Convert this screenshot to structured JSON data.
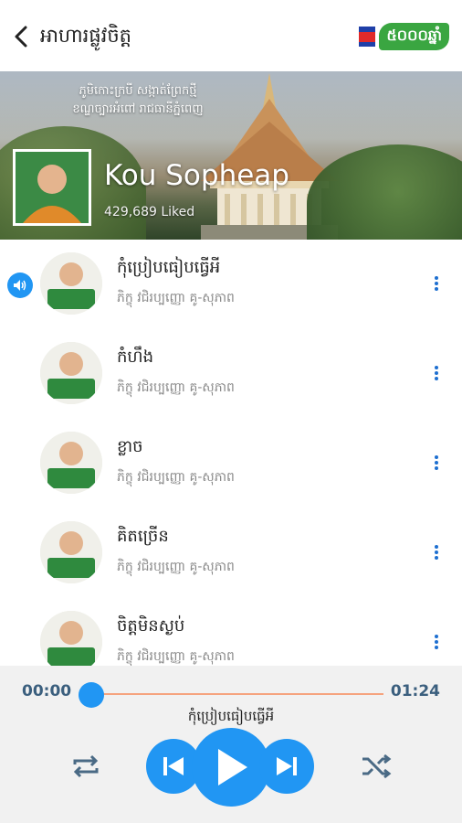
{
  "header": {
    "title": "អាហារផ្លូវចិត្ត",
    "logo_text": "៥០០០ឆ្នាំ"
  },
  "banner": {
    "caption_line1": "ភូមិកោះក្របី សង្កាត់ព្រែកថ្មី",
    "caption_line2": "ខណ្ឌច្បារអំពៅ រាជធានីភ្នំពេញ",
    "artist_name": "Kou Sopheap",
    "liked_text": "429,689 Liked"
  },
  "tracks": [
    {
      "title": "កុំប្រៀបធៀបធ្វើអី",
      "subtitle": "ភិក្ខុ វជិរប្បញ្ញោ គូ-សុភាព",
      "playing": true
    },
    {
      "title": "កំហឹង",
      "subtitle": "ភិក្ខុ វជិរប្បញ្ញោ គូ-សុភាព",
      "playing": false
    },
    {
      "title": "ខ្លាច",
      "subtitle": "ភិក្ខុ វជិរប្បញ្ញោ គូ-សុភាព",
      "playing": false
    },
    {
      "title": "គិតច្រើន",
      "subtitle": "ភិក្ខុ វជិរប្បញ្ញោ គូ-សុភាព",
      "playing": false
    },
    {
      "title": "ចិត្តមិនស្ងប់",
      "subtitle": "ភិក្ខុ វជិរប្បញ្ញោ គូ-សុភាព",
      "playing": false
    }
  ],
  "player": {
    "current_time": "00:00",
    "duration": "01:24",
    "progress": 0,
    "now_playing_title": "កុំប្រៀបធៀបធ្វើអី"
  },
  "colors": {
    "accent": "#2196f3",
    "time_text": "#3b5f7e",
    "seek_track": "#f5a37e",
    "logo_green": "#3aa641"
  }
}
